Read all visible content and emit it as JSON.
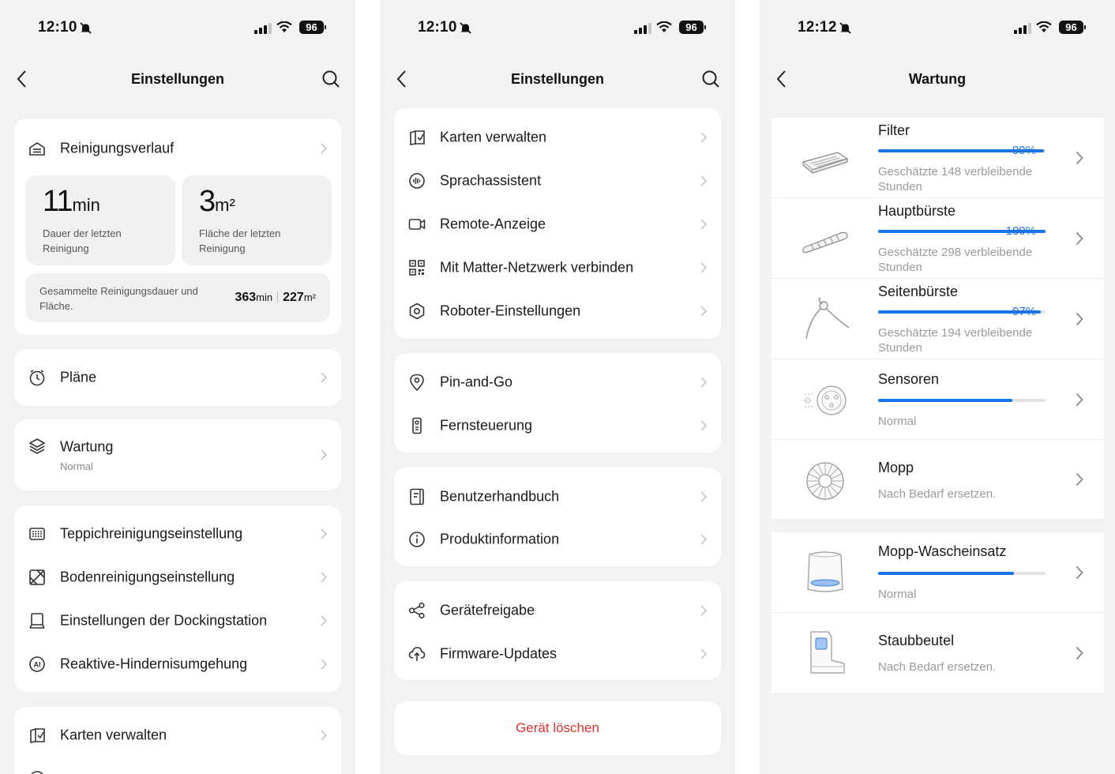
{
  "status_bar": {
    "time_1": "12:10",
    "time_2": "12:10",
    "time_3": "12:12",
    "battery": "96"
  },
  "screen1": {
    "title": "Einstellungen",
    "history": {
      "label": "Reinigungsverlauf",
      "duration_value": "11",
      "duration_unit": "min",
      "duration_label": "Dauer der letzten Reinigung",
      "area_value": "3",
      "area_unit": "m²",
      "area_label": "Fläche der letzten Reinigung",
      "total_label": "Gesammelte Reinigungsdauer und Fläche.",
      "total_duration_value": "363",
      "total_duration_unit": "min",
      "total_area_value": "227",
      "total_area_unit": "m²"
    },
    "plans_label": "Pläne",
    "maintenance": {
      "label": "Wartung",
      "status": "Normal"
    },
    "cleaning_items": [
      {
        "label": "Teppichreinigungseinstellung",
        "icon": "carpet-icon"
      },
      {
        "label": "Bodenreinigungseinstellung",
        "icon": "floor-icon"
      },
      {
        "label": "Einstellungen der Dockingstation",
        "icon": "dock-icon"
      },
      {
        "label": "Reaktive-Hindernisumgehung",
        "icon": "ai-icon"
      }
    ],
    "maps_label": "Karten verwalten"
  },
  "screen2": {
    "title": "Einstellungen",
    "group1": [
      {
        "label": "Karten verwalten",
        "icon": "map-icon"
      },
      {
        "label": "Sprachassistent",
        "icon": "voice-icon"
      },
      {
        "label": "Remote-Anzeige",
        "icon": "camera-icon"
      },
      {
        "label": "Mit Matter-Netzwerk verbinden",
        "icon": "qr-icon"
      },
      {
        "label": "Roboter-Einstellungen",
        "icon": "robot-settings-icon"
      }
    ],
    "group2": [
      {
        "label": "Pin-and-Go",
        "icon": "pin-icon"
      },
      {
        "label": "Fernsteuerung",
        "icon": "remote-icon"
      }
    ],
    "group3": [
      {
        "label": "Benutzerhandbuch",
        "icon": "manual-icon"
      },
      {
        "label": "Produktinformation",
        "icon": "info-icon"
      }
    ],
    "group4": [
      {
        "label": "Gerätefreigabe",
        "icon": "share-icon"
      },
      {
        "label": "Firmware-Updates",
        "icon": "cloud-upload-icon"
      }
    ],
    "delete_label": "Gerät löschen"
  },
  "screen3": {
    "title": "Wartung",
    "items": [
      {
        "name": "Filter",
        "percent": "99%",
        "level": 0.99,
        "desc": "Geschätzte 148 verbleibende Stunden",
        "icon": "filter-icon"
      },
      {
        "name": "Hauptbürste",
        "percent": "100%",
        "level": 1.0,
        "desc": "Geschätzte 298 verbleibende Stunden",
        "icon": "main-brush-icon"
      },
      {
        "name": "Seitenbürste",
        "percent": "97%",
        "level": 0.97,
        "desc": "Geschätzte 194 verbleibende Stunden",
        "icon": "side-brush-icon"
      },
      {
        "name": "Sensoren",
        "level": 0.8,
        "desc": "Normal",
        "icon": "sensor-icon"
      },
      {
        "name": "Mopp",
        "desc": "Nach Bedarf ersetzen.",
        "icon": "mop-icon"
      }
    ],
    "items2": [
      {
        "name": "Mopp-Wascheinsatz",
        "level": 0.81,
        "desc": "Normal",
        "icon": "wash-tray-icon"
      },
      {
        "name": "Staubbeutel",
        "desc": "Nach Bedarf ersetzen.",
        "icon": "dust-bag-icon"
      }
    ]
  },
  "colors": {
    "accent": "#1a73e8",
    "danger": "#e0312b",
    "background": "#f2f2f4"
  }
}
